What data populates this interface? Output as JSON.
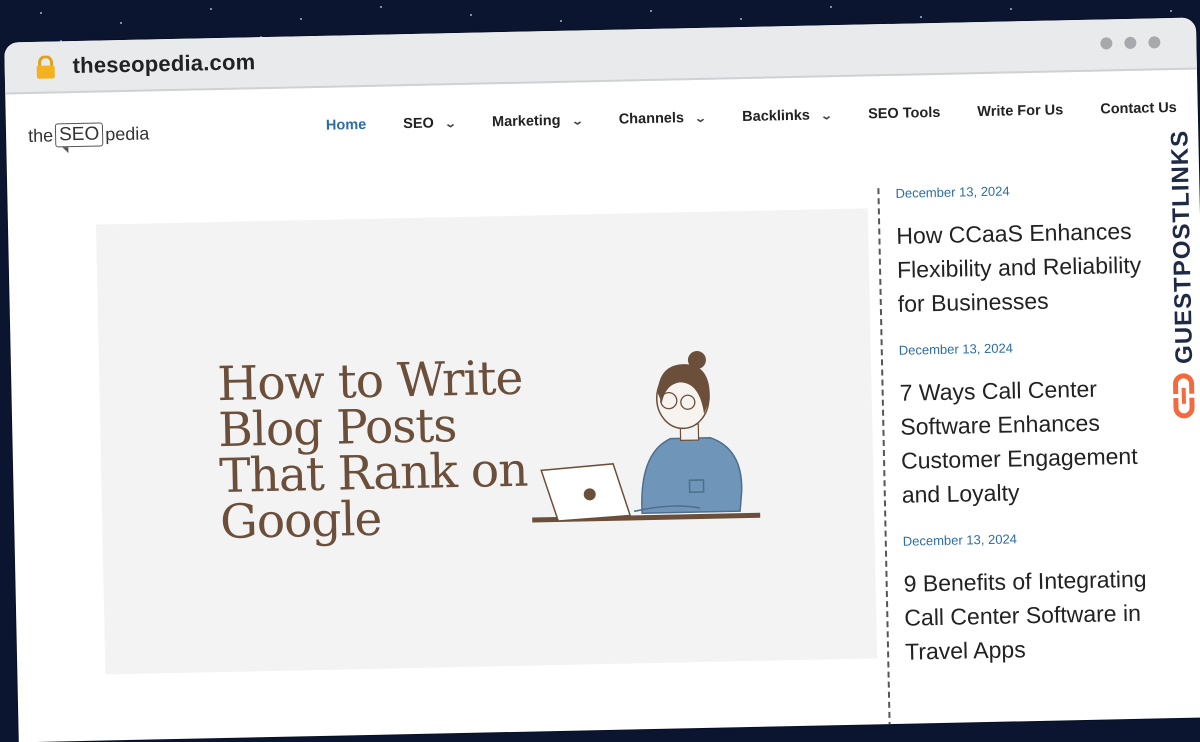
{
  "browser": {
    "url": "theseopedia.com"
  },
  "site": {
    "logo": {
      "left": "the",
      "box": "SEO",
      "right": "pedia"
    },
    "nav": [
      {
        "label": "Home",
        "dropdown": false,
        "active": true
      },
      {
        "label": "SEO",
        "dropdown": true,
        "active": false
      },
      {
        "label": "Marketing",
        "dropdown": true,
        "active": false
      },
      {
        "label": "Channels",
        "dropdown": true,
        "active": false
      },
      {
        "label": "Backlinks",
        "dropdown": true,
        "active": false
      },
      {
        "label": "SEO Tools",
        "dropdown": false,
        "active": false
      },
      {
        "label": "Write For Us",
        "dropdown": false,
        "active": false
      },
      {
        "label": "Contact Us",
        "dropdown": false,
        "active": false
      }
    ],
    "hero": {
      "title": "How to Write Blog Posts That Rank on Google"
    },
    "sidebar_posts": [
      {
        "date": "December 13, 2024",
        "title": "How CCaaS Enhances Flexibility and Reliability for Businesses"
      },
      {
        "date": "December 13, 2024",
        "title": "7 Ways Call Center Software Enhances Customer Engagement and Loyalty"
      },
      {
        "date": "December 13, 2024",
        "title": "9 Benefits of Integrating Call Center Software in Travel Apps"
      }
    ]
  },
  "watermark": {
    "text": "GUESTPOSTLINKS"
  },
  "colors": {
    "accent": "#2d6da3",
    "hero_text": "#6b4f3a",
    "brand_orange": "#f26a3d"
  }
}
